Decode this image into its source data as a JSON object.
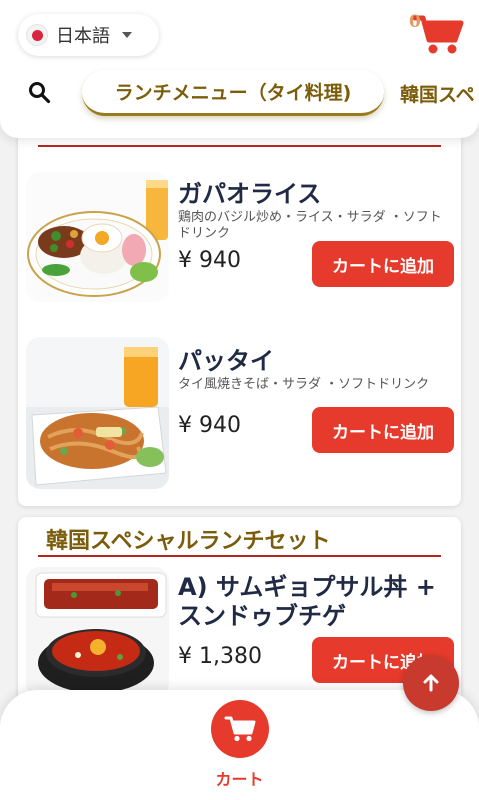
{
  "header": {
    "language": "日本語",
    "cart_count": "0",
    "tabs": [
      {
        "label": "ランチメニュー（タイ料理)",
        "active": true
      },
      {
        "label": "韓国スペ",
        "active": false
      }
    ]
  },
  "sections": [
    {
      "items": [
        {
          "name": "ガパオライス",
          "description": "鶏肉のバジル炒め・ライス・サラダ ・ソフトドリンク",
          "price": "¥ 940",
          "button": "カートに追加"
        },
        {
          "name": "パッタイ",
          "description": "タイ風焼きそば・サラダ ・ソフトドリンク",
          "price": "¥ 940",
          "button": "カートに追加"
        }
      ]
    },
    {
      "title": "韓国スペシャルランチセット",
      "items": [
        {
          "name_line1": "A) サムギョプサル丼 +",
          "name_line2": "スンドゥブチゲ",
          "price": "¥ 1,380",
          "button": "カートに追加"
        }
      ]
    }
  ],
  "bottom_nav": {
    "cart_label": "カート"
  },
  "colors": {
    "accent": "#e53a2c",
    "gold": "#7a5c0a",
    "rule": "#b5281f"
  },
  "icons": [
    "flag-japan-icon",
    "chevron-down-icon",
    "cart-icon",
    "search-icon",
    "arrow-up-icon"
  ]
}
